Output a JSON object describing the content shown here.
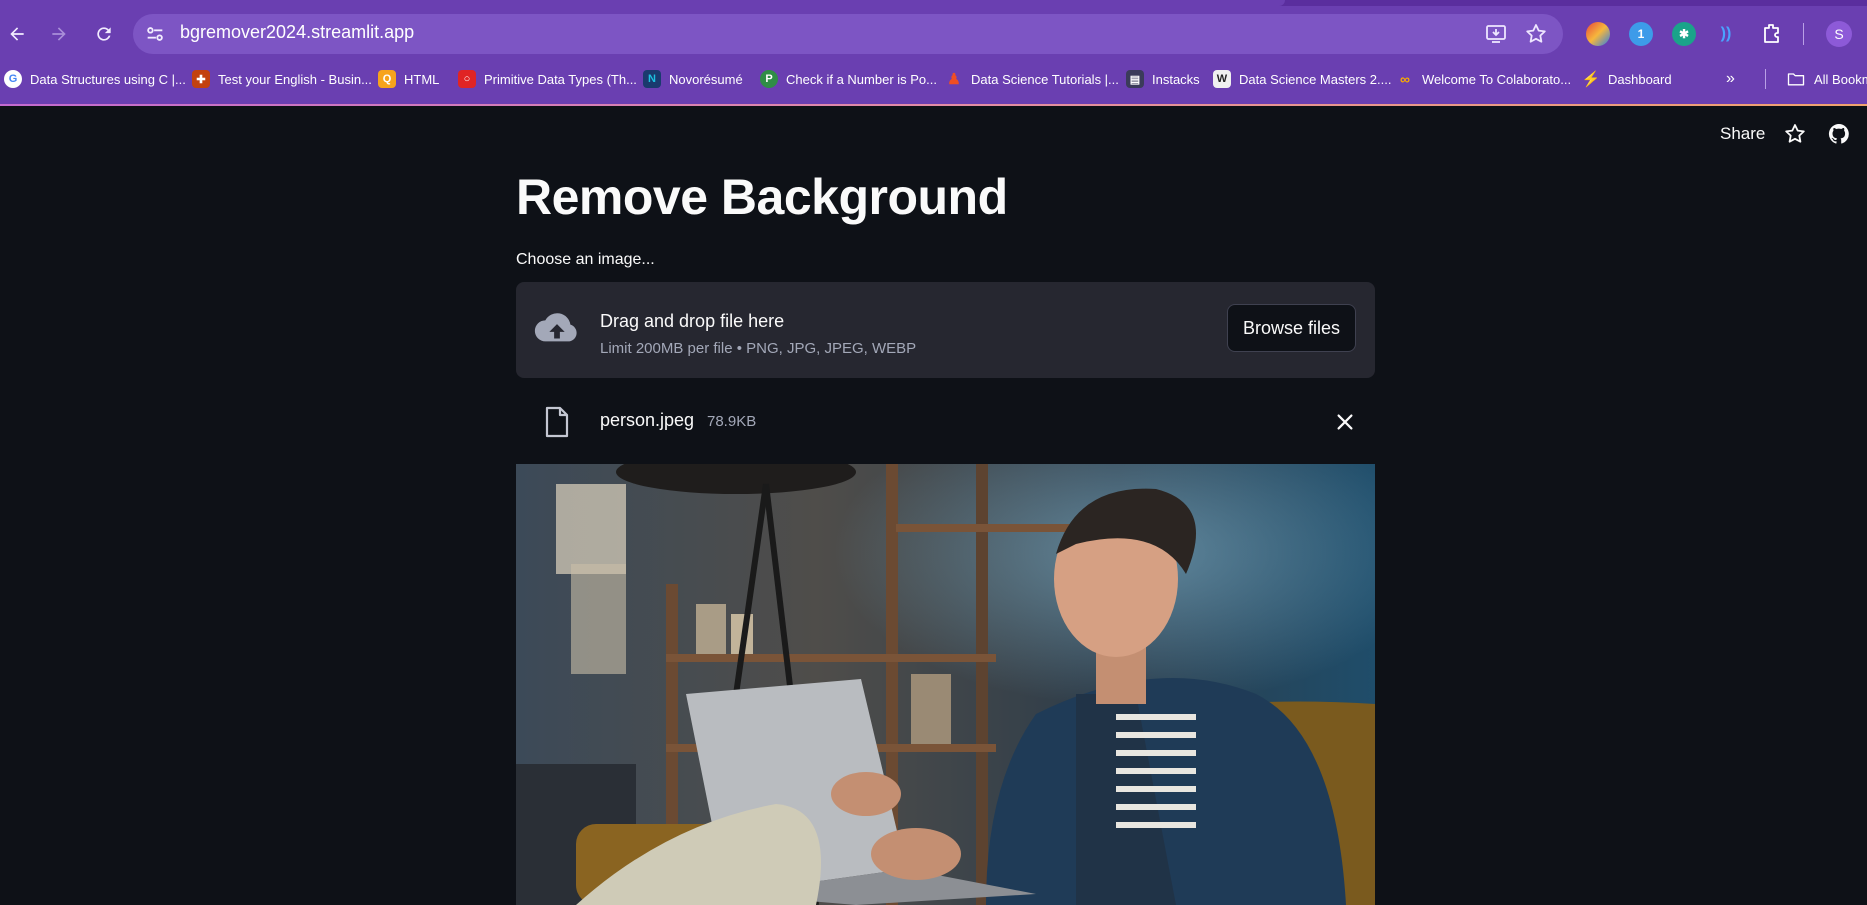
{
  "browser": {
    "url": "bgremover2024.streamlit.app",
    "profile_initial": "S",
    "bookmarks": [
      {
        "label": "Data Structures using C |...",
        "icon": "google-icon",
        "color": "#ffffff"
      },
      {
        "label": "Test your English - Busin...",
        "icon": "cambridge-icon",
        "color": "#c3410f"
      },
      {
        "label": "HTML",
        "icon": "html-icon",
        "color": "#f7a31c"
      },
      {
        "label": "Primitive Data Types (Th...",
        "icon": "oracle-icon",
        "color": "#e02424"
      },
      {
        "label": "Novorésumé",
        "icon": "novoresume-icon",
        "color": "#1dc1e0"
      },
      {
        "label": "Check if a Number is Po...",
        "icon": "gfg-icon",
        "color": "#2f8d46"
      },
      {
        "label": "Data Science Tutorials |...",
        "icon": "person-icon",
        "color": "#f04e23"
      },
      {
        "label": "Instacks",
        "icon": "instacks-icon",
        "color": "#3b3b5a"
      },
      {
        "label": "Data Science Masters 2....",
        "icon": "pw-icon",
        "color": "#222222"
      },
      {
        "label": "Welcome To Colaborato...",
        "icon": "colab-icon",
        "color": "#f9ab00"
      },
      {
        "label": "Dashboard",
        "icon": "dashboard-icon",
        "color": "#4a7bf7"
      }
    ],
    "all_bookmarks_label": "All Bookm"
  },
  "app": {
    "share_label": "Share",
    "title": "Remove Background",
    "uploader_label": "Choose an image...",
    "dropzone_title": "Drag and drop file here",
    "dropzone_subtitle": "Limit 200MB per file • PNG, JPG, JPEG, WEBP",
    "browse_label": "Browse files",
    "file": {
      "name": "person.jpeg",
      "size": "78.9KB"
    }
  },
  "colors": {
    "chrome": "#6a3fb1",
    "page_bg": "#0e1117",
    "dropzone_bg": "#262730",
    "text": "#fafafa",
    "muted": "#a3a8b8"
  }
}
